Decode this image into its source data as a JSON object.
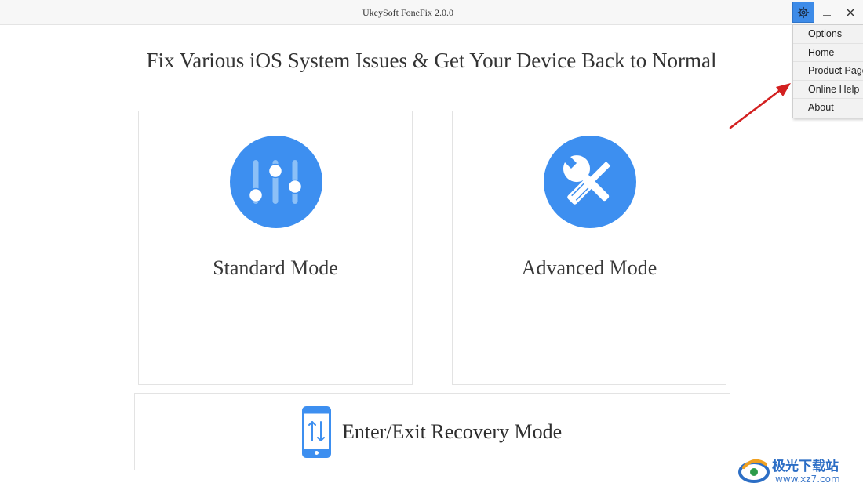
{
  "window": {
    "title": "UkeySoft FoneFix 2.0.0"
  },
  "menu": {
    "items": [
      {
        "label": "Options"
      },
      {
        "label": "Home"
      },
      {
        "label": "Product Page"
      },
      {
        "label": "Online Help"
      },
      {
        "label": "About"
      }
    ]
  },
  "main": {
    "headline": "Fix Various iOS System Issues & Get Your Device Back to Normal",
    "modes": [
      {
        "label": "Standard Mode",
        "icon": "sliders-icon"
      },
      {
        "label": "Advanced Mode",
        "icon": "tools-icon"
      }
    ],
    "recovery": {
      "label": "Enter/Exit Recovery Mode",
      "icon": "phone-transfer-icon"
    }
  },
  "watermark": {
    "title": "极光下载站",
    "url": "www.xz7.com"
  },
  "colors": {
    "accent": "#3d8ff0",
    "settings_button": "#3d8be8",
    "annotation_arrow": "#d32020"
  }
}
